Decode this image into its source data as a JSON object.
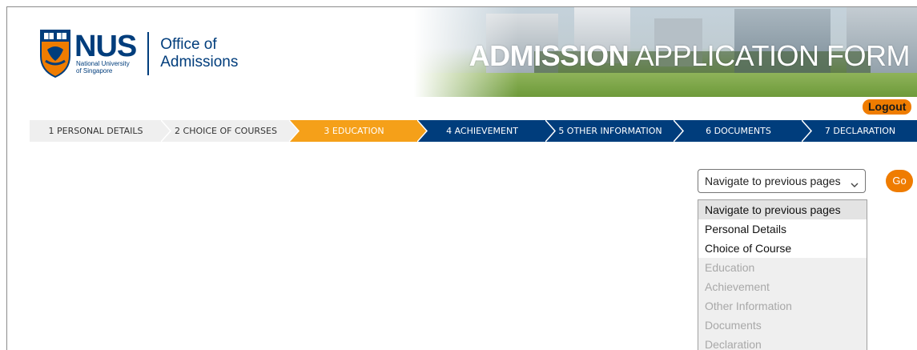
{
  "header": {
    "logo_text": "NUS",
    "logo_sub_line1": "National University",
    "logo_sub_line2": "of Singapore",
    "office_line1": "Office of",
    "office_line2": "Admissions",
    "banner_title_bold": "ADMISSION",
    "banner_title_rest": " APPLICATION FORM",
    "logout_label": "Logout"
  },
  "steps": [
    {
      "label": "1 PERSONAL DETAILS",
      "state": "done"
    },
    {
      "label": "2 CHOICE OF COURSES",
      "state": "done"
    },
    {
      "label": "3 EDUCATION",
      "state": "active"
    },
    {
      "label": "4 ACHIEVEMENT",
      "state": "todo"
    },
    {
      "label": "5 OTHER INFORMATION",
      "state": "todo"
    },
    {
      "label": "6 DOCUMENTS",
      "state": "todo"
    },
    {
      "label": "7 DECLARATION",
      "state": "todo"
    }
  ],
  "navigate": {
    "selected": "Navigate to previous pages",
    "go_label": "Go",
    "options": [
      {
        "label": "Navigate to previous pages",
        "state": "highlighted"
      },
      {
        "label": "Personal Details",
        "state": "enabled"
      },
      {
        "label": "Choice of Course",
        "state": "enabled"
      },
      {
        "label": "Education",
        "state": "disabled"
      },
      {
        "label": "Achievement",
        "state": "disabled"
      },
      {
        "label": "Other Information",
        "state": "disabled"
      },
      {
        "label": "Documents",
        "state": "disabled"
      },
      {
        "label": "Declaration",
        "state": "disabled"
      }
    ]
  },
  "colors": {
    "nus_blue": "#003d7c",
    "nus_orange": "#ef7c00",
    "active_step": "#f5a019",
    "done_step": "#efefef"
  }
}
